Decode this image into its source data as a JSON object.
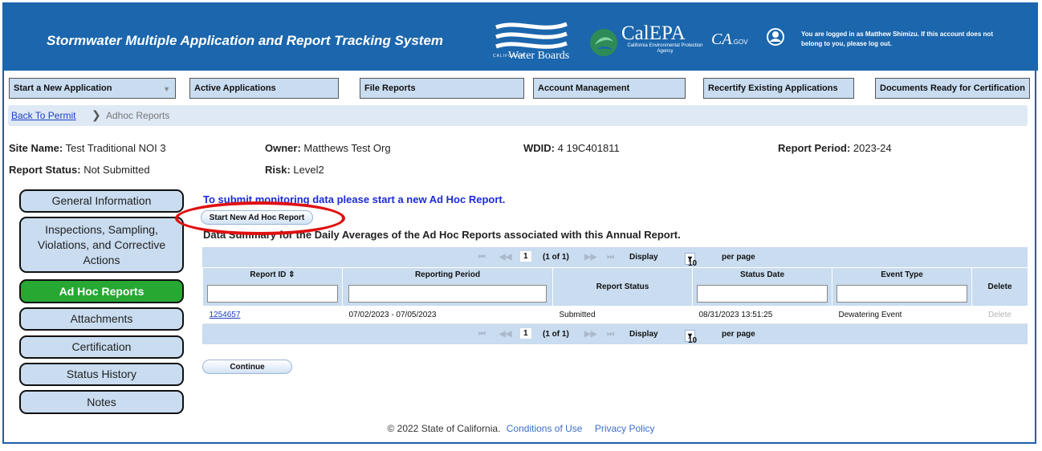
{
  "header": {
    "title": "Stormwater Multiple Application and Report Tracking System",
    "water_boards_small": "CALIFORNIA",
    "water_boards": "Water Boards",
    "calepa": "CalEPA",
    "calepa_sub": "California Environmental Protection Agency",
    "cagov_ca": "CA",
    "cagov_gov": ".GOV",
    "login_message": "You are logged in as Matthew Shimizu. If this account does not belong to you, please log out.",
    "colors": {
      "header_bg": "#1b66ad",
      "active": "#27a833",
      "annotation": "#e01010"
    }
  },
  "nav": [
    "Start a New Application",
    "Active Applications",
    "File Reports",
    "Account Management",
    "Recertify Existing Applications",
    "Documents Ready for Certification"
  ],
  "breadcrumb": {
    "link": "Back To Permit",
    "separator": "❯",
    "current": "Adhoc Reports"
  },
  "site_info": {
    "site_name_label": "Site Name:",
    "site_name": "Test Traditional NOI 3",
    "owner_label": "Owner:",
    "owner": "Matthews Test Org",
    "wdid_label": "WDID:",
    "wdid": "4 19C401811",
    "report_period_label": "Report Period:",
    "report_period": "2023-24",
    "report_status_label": "Report Status:",
    "report_status": "Not Submitted",
    "risk_label": "Risk:",
    "risk": "Level2"
  },
  "sidebar": [
    "General Information",
    "Inspections, Sampling, Violations, and Corrective Actions",
    "Ad Hoc Reports",
    "Attachments",
    "Certification",
    "Status History",
    "Notes"
  ],
  "main": {
    "message": "To submit monitoring data please start a new Ad Hoc Report.",
    "start_button": "Start New Ad Hoc Report",
    "summary_heading": "Data Summary for the Daily Averages of the Ad Hoc Reports associated with this Annual Report.",
    "continue_button": "Continue"
  },
  "pager": {
    "first": "⏮",
    "prev": "◀◀",
    "page": "1",
    "count": "(1 of 1)",
    "next": "▶▶",
    "last": "⏭",
    "display_label": "Display",
    "per_page_value": "10",
    "per_page_label": "per page"
  },
  "table": {
    "headers": [
      "Report ID ⇕",
      "Reporting Period",
      "Report Status",
      "Status Date",
      "Event Type",
      "Delete"
    ],
    "rows": [
      [
        "1254657",
        "07/02/2023 - 07/05/2023",
        "Submitted",
        "08/31/2023 13:51:25",
        "Dewatering Event",
        "Delete"
      ]
    ]
  },
  "footer": {
    "copyright": "© 2022 State of California.",
    "conditions": "Conditions of Use",
    "privacy": "Privacy Policy"
  }
}
